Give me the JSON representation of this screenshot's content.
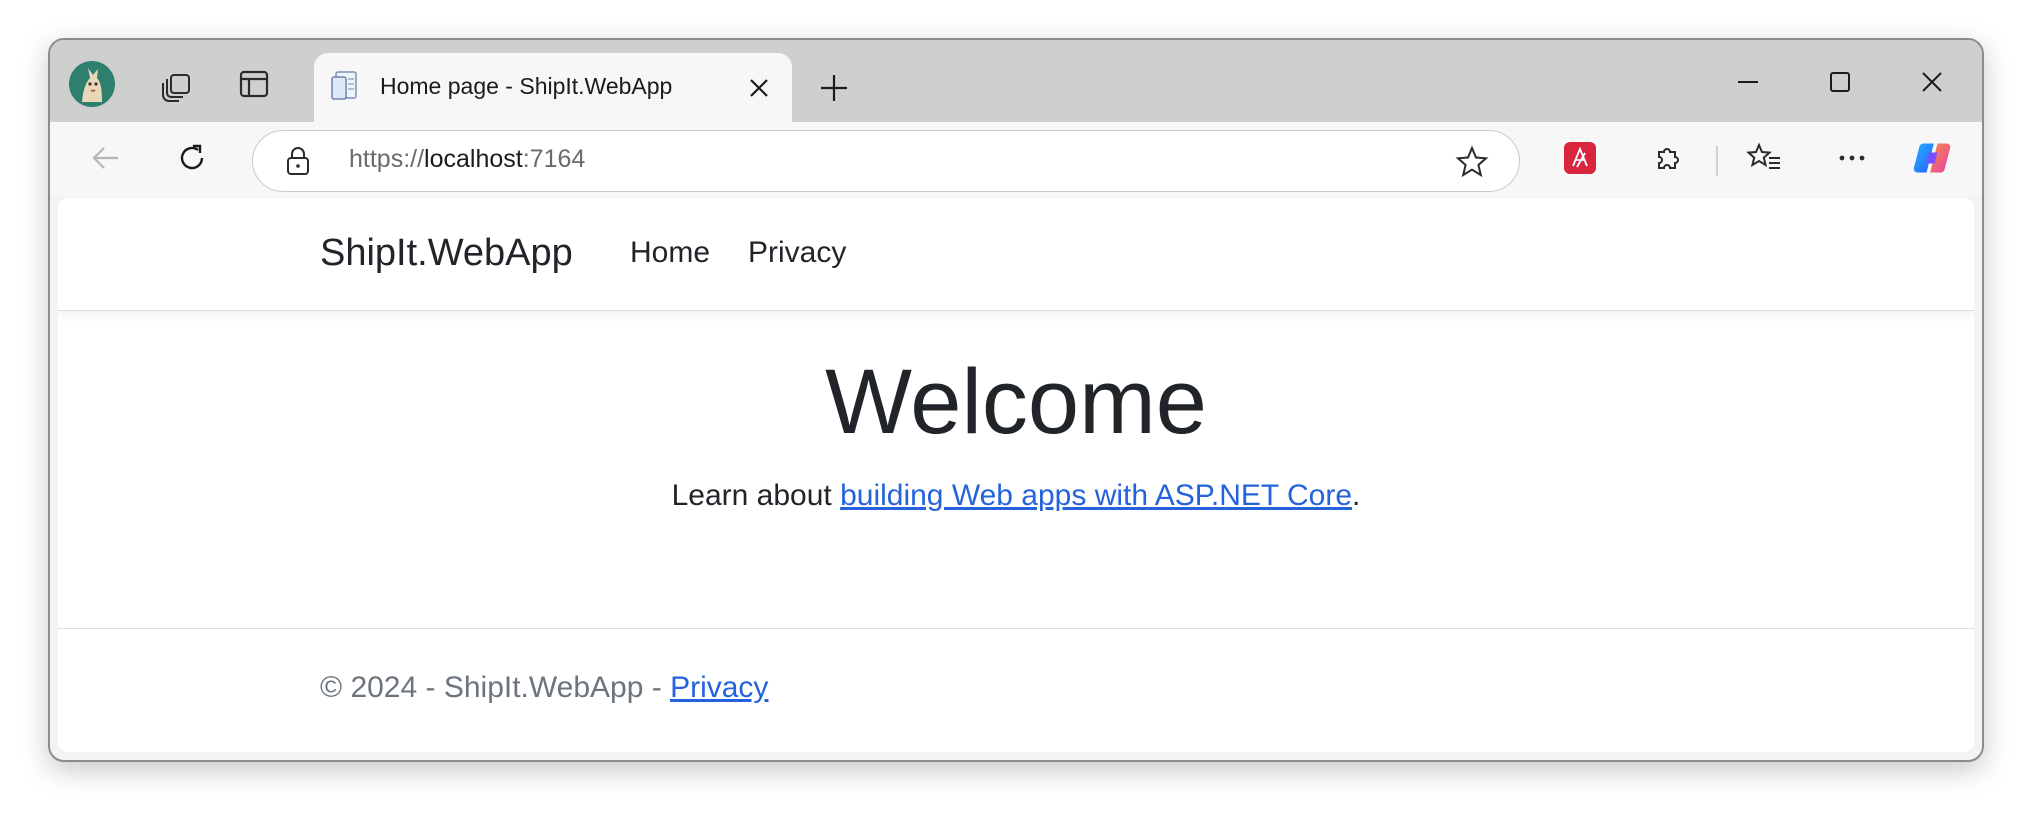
{
  "browser": {
    "tab": {
      "title": "Home page - ShipIt.WebApp"
    },
    "address": {
      "scheme": "https://",
      "host": "localhost",
      "port": ":7164"
    },
    "icons": {
      "profile": "profile-avatar-icon",
      "workspaces": "workspaces-icon",
      "vertical_tabs": "vertical-tabs-icon",
      "new_tab": "plus-icon",
      "back": "back-arrow-icon",
      "refresh": "refresh-icon",
      "lock": "lock-icon",
      "favorite": "star-icon",
      "extension_pdf": "acrobat-extension-icon",
      "extensions": "puzzle-icon",
      "favorites": "favorites-list-icon",
      "more": "ellipsis-icon",
      "copilot": "copilot-icon"
    },
    "accent_colors": {
      "acrobat": "#d7263d",
      "link": "#2463dc"
    }
  },
  "site": {
    "brand": "ShipIt.WebApp",
    "nav": [
      {
        "label": "Home"
      },
      {
        "label": "Privacy"
      }
    ],
    "heading": "Welcome",
    "lead": {
      "prefix": "Learn about ",
      "link": "building Web apps with ASP.NET Core",
      "suffix": "."
    },
    "footer": {
      "text": "© 2024 - ShipIt.WebApp - ",
      "link": "Privacy"
    }
  }
}
